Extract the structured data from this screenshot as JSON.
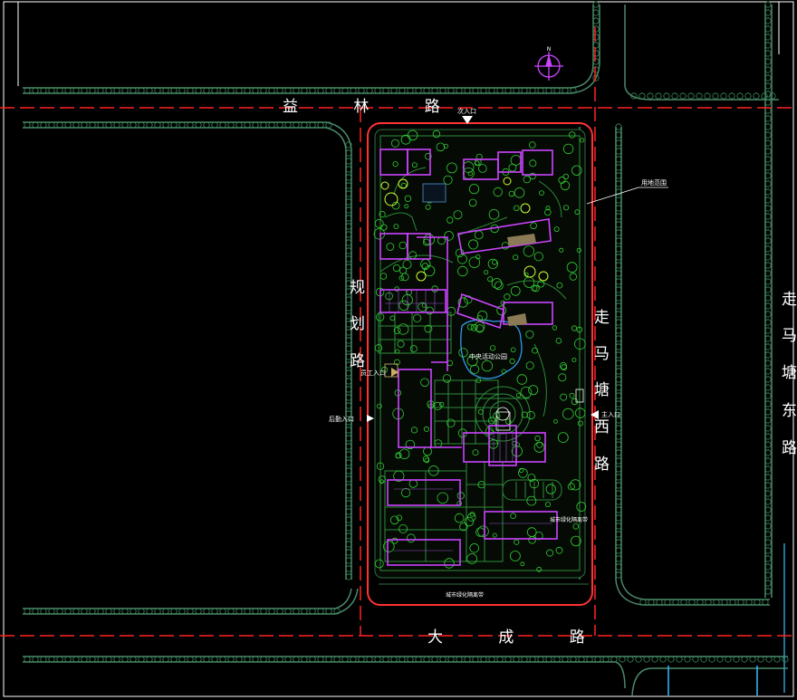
{
  "roads": {
    "north": "益 林 路",
    "south": "大 成 路",
    "west": [
      "规",
      "划",
      "路"
    ],
    "east_inner": [
      "走",
      "马",
      "塘",
      "西",
      "路"
    ],
    "east_outer": [
      "走",
      "马",
      "塘",
      "东",
      "路"
    ]
  },
  "entrances": {
    "secondary": "次入口",
    "main": "主入口",
    "staff": "员工入口",
    "logistics": "后勤入口"
  },
  "callouts": {
    "boundary": "用地范围",
    "park": "中央活动公园",
    "green_belt_south": "城市绿化隔离带",
    "green_belt_east": "城市绿化隔离带"
  },
  "compass": {
    "north_label": "N"
  },
  "colors": {
    "background": "#000000",
    "road_edge": "#4a8a6a",
    "centerline": "#ff2222",
    "site_boundary": "#ff3333",
    "building": "#cc44ff",
    "vegetation": "#33cc33",
    "text": "#ffffff",
    "frame": "#ffffff"
  }
}
